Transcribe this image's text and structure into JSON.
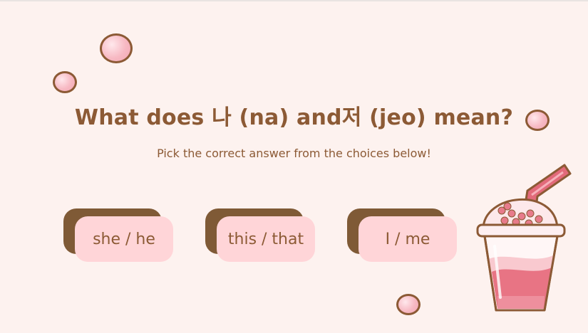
{
  "slide": {
    "title": "What does 나 (na) and저 (jeo) mean?",
    "subtitle": "Pick the correct answer from the choices below!"
  },
  "choices": [
    {
      "label": "she / he"
    },
    {
      "label": "this / that"
    },
    {
      "label": "I / me"
    }
  ],
  "colors": {
    "background": "#fdf2ef",
    "text": "#8c5a35",
    "button_face": "#ffd5d8",
    "button_shadow": "#7f5a36"
  },
  "decorations": [
    "tapioca-pearl",
    "bubble-tea-cup-icon"
  ]
}
